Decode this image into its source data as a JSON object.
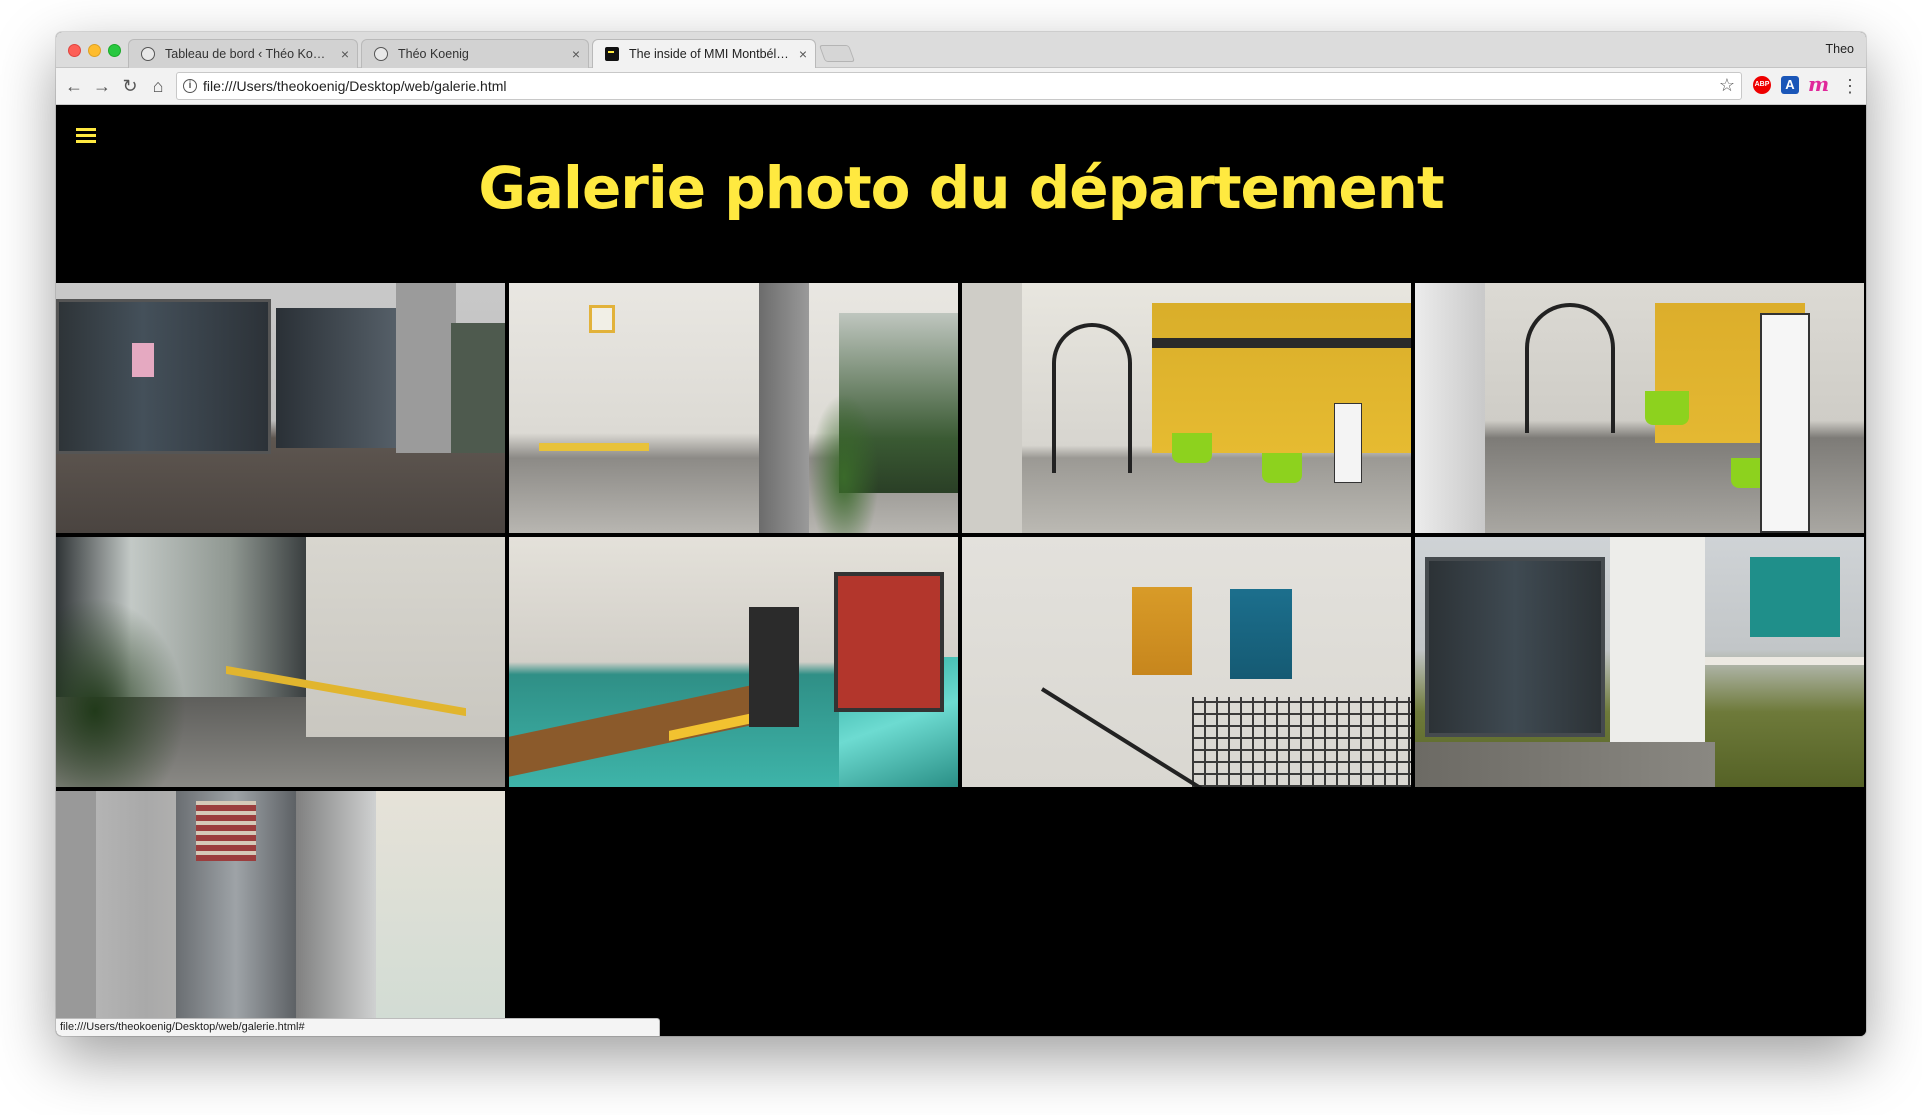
{
  "browser": {
    "tabs": [
      {
        "title": "Tableau de bord ‹ Théo Koenig",
        "active": false,
        "icon": "wordpress-icon"
      },
      {
        "title": "Théo Koenig",
        "active": false,
        "icon": "wordpress-icon"
      },
      {
        "title": "The inside of MMI Montbéliard",
        "active": true,
        "icon": "site-favicon"
      }
    ],
    "tab_close_glyph": "×",
    "profile_name": "Theo",
    "url": "file:///Users/theokoenig/Desktop/web/galerie.html",
    "status_url": "file:///Users/theokoenig/Desktop/web/galerie.html#",
    "extensions": [
      {
        "name": "adblock-plus-icon",
        "label": "ABP"
      },
      {
        "name": "translate-icon",
        "label": "A"
      },
      {
        "name": "mercury-icon",
        "label": "m"
      }
    ]
  },
  "page": {
    "title": "Galerie photo du département",
    "accent_color": "#ffe940",
    "background_color": "#000000"
  },
  "gallery": {
    "photos": [
      {
        "id": "photo-1",
        "subject": "building-entrance"
      },
      {
        "id": "photo-2",
        "subject": "white-hall"
      },
      {
        "id": "photo-3",
        "subject": "yellow-atrium"
      },
      {
        "id": "photo-4",
        "subject": "hall-with-sign"
      },
      {
        "id": "photo-5",
        "subject": "glass-hall"
      },
      {
        "id": "photo-6",
        "subject": "teal-corridor"
      },
      {
        "id": "photo-7",
        "subject": "stairwell-posters"
      },
      {
        "id": "photo-8",
        "subject": "building-exterior"
      },
      {
        "id": "photo-9",
        "subject": "vending-machine"
      }
    ]
  }
}
